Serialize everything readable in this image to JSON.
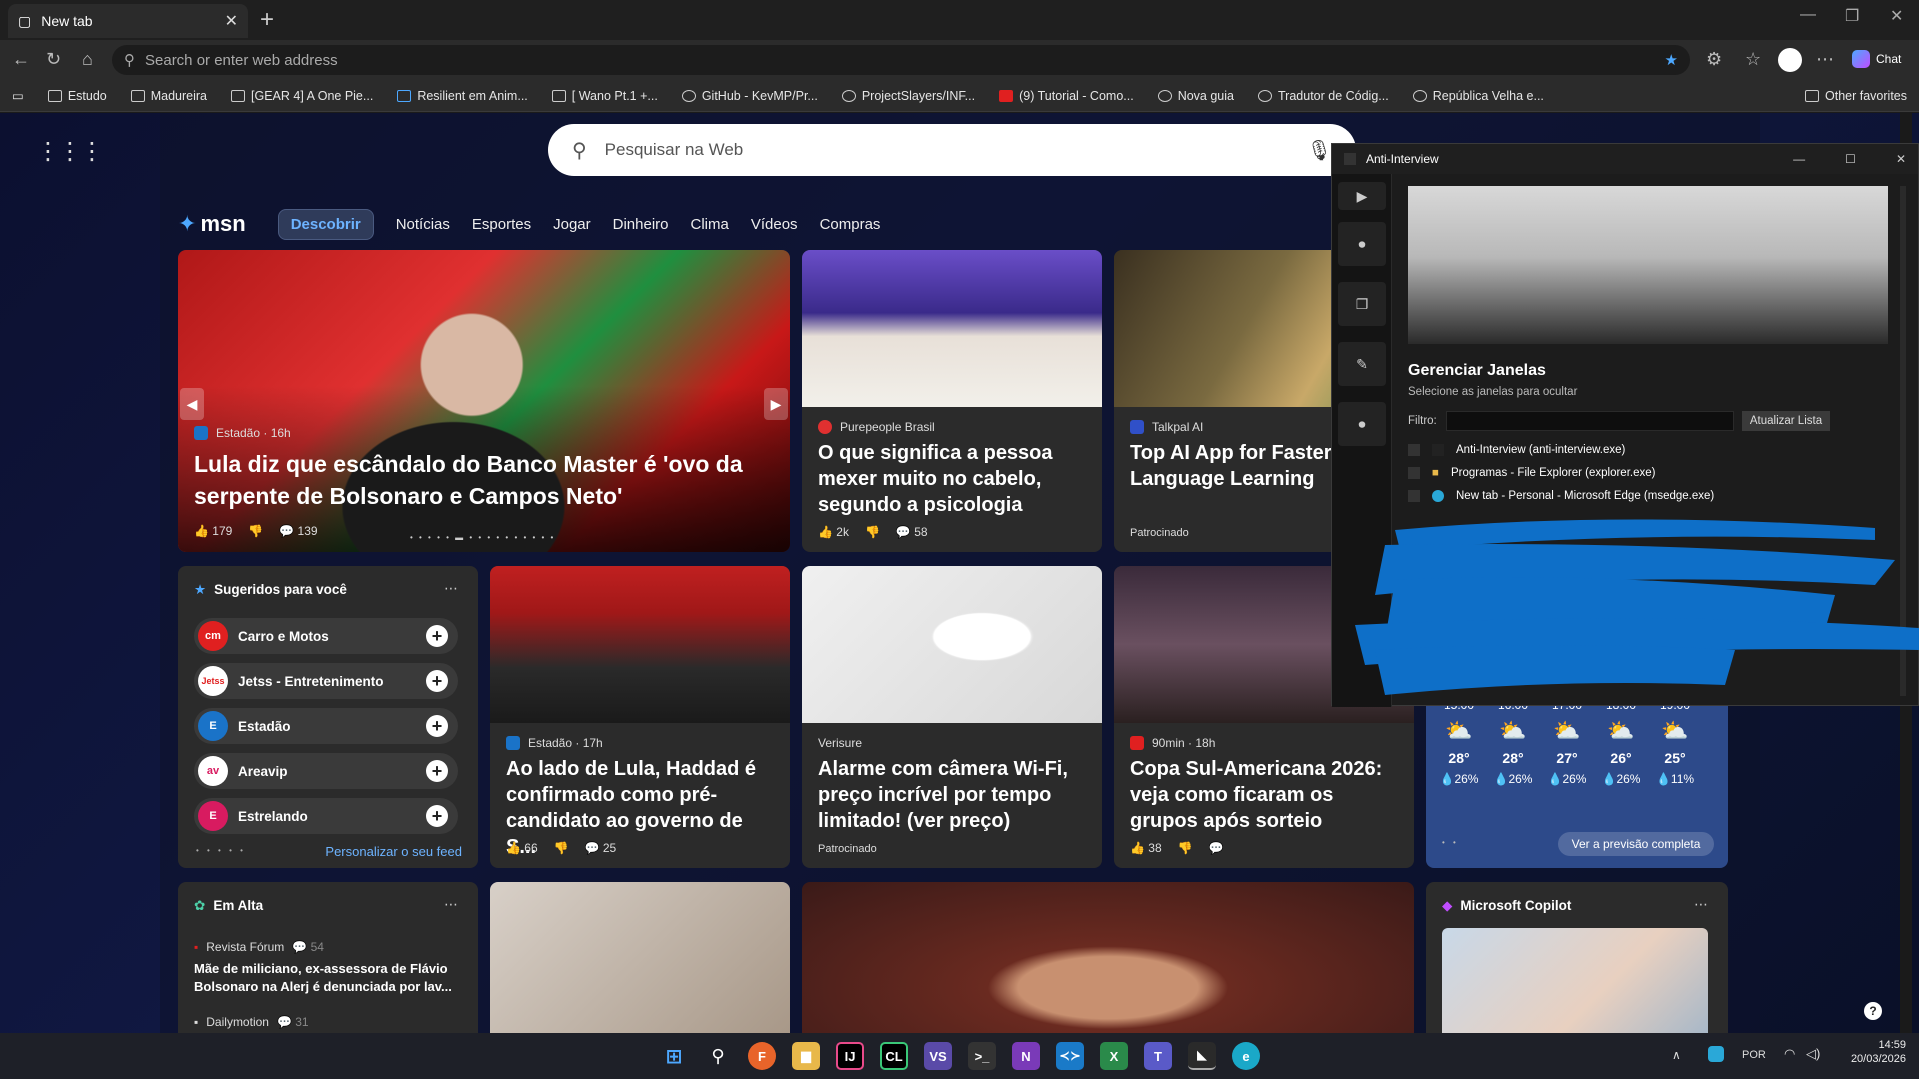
{
  "browser": {
    "tab_title": "New tab",
    "address_placeholder": "Search or enter web address",
    "chat_label": "Chat",
    "bookmarks": [
      "Estudo",
      "Madureira",
      "[GEAR 4] A One Pie...",
      "Resilient em Anim...",
      "[ Wano Pt.1 +...",
      "GitHub - KevMP/Pr...",
      "ProjectSlayers/INF...",
      "(9) Tutorial - Como...",
      "Nova guia",
      "Tradutor de Códig...",
      "República Velha e..."
    ],
    "other_favorites": "Other favorites"
  },
  "msn": {
    "search_placeholder": "Pesquisar na Web",
    "logo": "msn",
    "nav": [
      "Descobrir",
      "Notícias",
      "Esportes",
      "Jogar",
      "Dinheiro",
      "Clima",
      "Vídeos",
      "Compras"
    ],
    "hero": {
      "source": "Estadão · 16h",
      "title": "Lula diz que escândalo do Banco Master é 'ovo da serpente de Bolsonaro e Campos Neto'",
      "likes": "179",
      "comments": "139"
    },
    "card2": {
      "source": "Purepeople Brasil",
      "title": "O que significa a pessoa mexer muito no cabelo, segundo a psicologia",
      "likes": "2k",
      "comments": "58"
    },
    "card3": {
      "source": "Talkpal AI",
      "title": "Top AI App for Faster Language Learning",
      "sponsored": "Patrocinado"
    },
    "suggested": {
      "title": "Sugeridos para você",
      "items": [
        {
          "name": "Carro e Motos",
          "logo": "cm",
          "color": "#e02020"
        },
        {
          "name": "Jetss - Entretenimento",
          "logo": "Jetss",
          "color": "#ffffff"
        },
        {
          "name": "Estadão",
          "logo": "E",
          "color": "#1a73c8"
        },
        {
          "name": "Areavip",
          "logo": "av",
          "color": "#ffffff"
        },
        {
          "name": "Estrelando",
          "logo": "E",
          "color": "#d81b60"
        }
      ],
      "personalize": "Personalizar o seu feed"
    },
    "card4": {
      "source": "Estadão · 17h",
      "title": "Ao lado de Lula, Haddad é confirmado como pré-candidato ao governo de S...",
      "likes": "66",
      "comments": "25"
    },
    "card5": {
      "source": "Verisure",
      "title": "Alarme com câmera Wi-Fi, preço incrível por tempo limitado! (ver preço)",
      "sponsored": "Patrocinado"
    },
    "card6": {
      "source": "90min · 18h",
      "title": "Copa Sul-Americana 2026: veja como ficaram os grupos após sorteio",
      "likes": "38"
    },
    "weather": {
      "hours": [
        {
          "t": "15:00",
          "temp": "28°",
          "rain": "26%"
        },
        {
          "t": "16:00",
          "temp": "28°",
          "rain": "26%"
        },
        {
          "t": "17:00",
          "temp": "27°",
          "rain": "26%"
        },
        {
          "t": "18:00",
          "temp": "26°",
          "rain": "26%"
        },
        {
          "t": "19:00",
          "temp": "25°",
          "rain": "11%"
        }
      ],
      "forecast_link": "Ver a previsão completa"
    },
    "trending": {
      "title": "Em Alta",
      "source": "Revista Fórum",
      "comments": "54",
      "headline": "Mãe de miliciano, ex-assessora de Flávio Bolsonaro na Alerj é denunciada por lav...",
      "source2": "Dailymotion",
      "comments2": "31"
    },
    "copilot": {
      "title": "Microsoft Copilot"
    }
  },
  "anti": {
    "title": "Anti-Interview",
    "heading": "Gerenciar Janelas",
    "subtitle": "Selecione as janelas para ocultar",
    "filter_label": "Filtro:",
    "refresh": "Atualizar Lista",
    "windows": [
      "Anti-Interview (anti-interview.exe)",
      "Programas - File Explorer (explorer.exe)",
      "New tab - Personal - Microsoft Edge (msedge.exe)"
    ]
  },
  "taskbar": {
    "lang": "POR",
    "time": "14:59",
    "date": "20/03/2026"
  }
}
